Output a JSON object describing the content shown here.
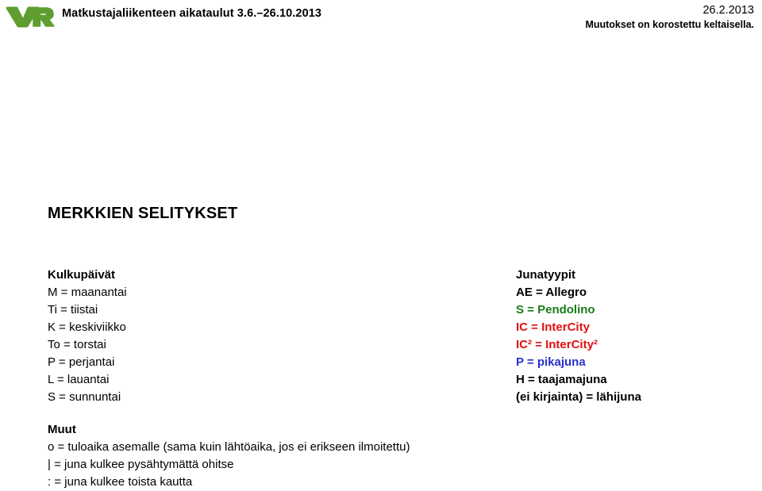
{
  "header": {
    "logo_alt": "VR",
    "logo_color": "#5e9e31",
    "title": "Matkustajaliikenteen aikataulut 3.6.–26.10.2013",
    "date": "26.2.2013",
    "note": "Muutokset on korostettu keltaisella."
  },
  "main_heading": "MERKKIEN SELITYKSET",
  "colors": {
    "black": "#000000",
    "green": "#167d16",
    "red": "#e01010",
    "blue": "#2832cc"
  },
  "legend": {
    "days": {
      "heading": "Kulkupäivät",
      "rows": [
        "M = maanantai",
        "Ti = tiistai",
        "K = keskiviikko",
        "To = torstai",
        "P = perjantai",
        "L = lauantai",
        "S = sunnuntai"
      ]
    },
    "train_types": {
      "heading": "Junatyypit",
      "rows": [
        {
          "text": "AE = Allegro",
          "color": "#000000"
        },
        {
          "text": "S = Pendolino",
          "color": "#167d16"
        },
        {
          "text": "IC = InterCity",
          "color": "#e01010"
        },
        {
          "text": "IC² = InterCity²",
          "color": "#e01010"
        },
        {
          "text": "P = pikajuna",
          "color": "#2832cc"
        },
        {
          "text": "H = taajamajuna",
          "color": "#000000"
        },
        {
          "text": "(ei kirjainta) = lähijuna",
          "color": "#000000"
        }
      ]
    },
    "other": {
      "heading": "Muut",
      "rows": [
        "o = tuloaika asemalle (sama kuin lähtöaika, jos ei erikseen ilmoitettu)",
        "| = juna kulkee pysähtymättä ohitse",
        ": = juna kulkee toista kautta"
      ]
    }
  }
}
